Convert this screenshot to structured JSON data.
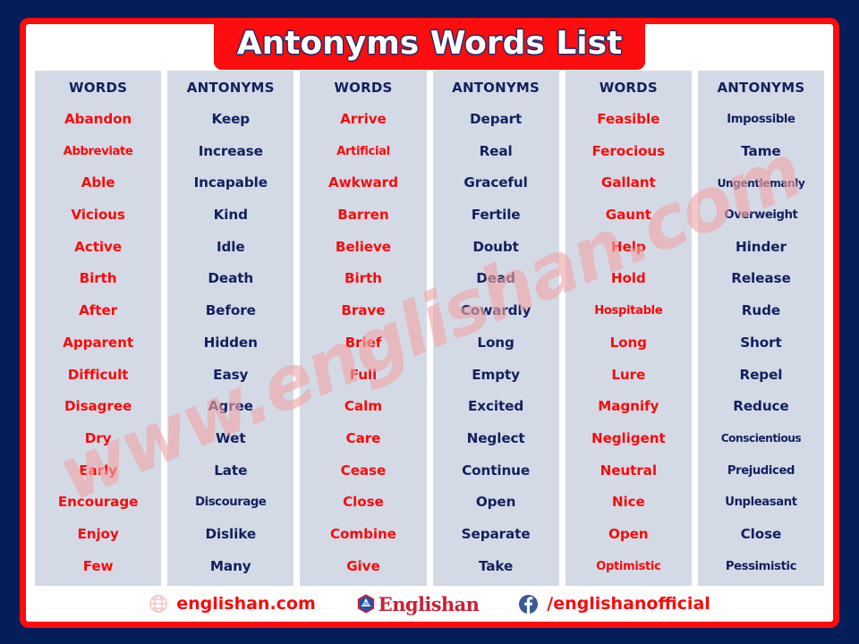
{
  "page": {
    "title": "Antonyms Words List",
    "background_color": "#041e5a",
    "border_color": "#fd0d0d",
    "cell_background": "#d3dae6",
    "word_color": "#fb0a0a",
    "antonym_color": "#13205e"
  },
  "table": {
    "headers": [
      "WORDS",
      "ANTONYMS",
      "WORDS",
      "ANTONYMS",
      "WORDS",
      "ANTONYMS"
    ],
    "columns": [
      {
        "header": "WORDS",
        "kind": "words",
        "cells": [
          "Abandon",
          "Abbreviate",
          "Able",
          "Vicious",
          "Active",
          "Birth",
          "After",
          "Apparent",
          "Difficult",
          "Disagree",
          "Dry",
          "Early",
          "Encourage",
          "Enjoy",
          "Few"
        ]
      },
      {
        "header": "ANTONYMS",
        "kind": "antonyms",
        "cells": [
          "Keep",
          "Increase",
          "Incapable",
          "Kind",
          "Idle",
          "Death",
          "Before",
          "Hidden",
          "Easy",
          "Agree",
          "Wet",
          "Late",
          "Discourage",
          "Dislike",
          "Many"
        ]
      },
      {
        "header": "WORDS",
        "kind": "words",
        "cells": [
          "Arrive",
          "Artificial",
          "Awkward",
          "Barren",
          "Believe",
          "Birth",
          "Brave",
          "Brief",
          "Full",
          "Calm",
          "Care",
          "Cease",
          "Close",
          "Combine",
          "Give"
        ]
      },
      {
        "header": "ANTONYMS",
        "kind": "antonyms",
        "cells": [
          "Depart",
          "Real",
          "Graceful",
          "Fertile",
          "Doubt",
          "Dead",
          "Cowardly",
          "Long",
          "Empty",
          "Excited",
          "Neglect",
          "Continue",
          "Open",
          "Separate",
          "Take"
        ]
      },
      {
        "header": "WORDS",
        "kind": "words",
        "cells": [
          "Feasible",
          "Ferocious",
          "Gallant",
          "Gaunt",
          "Help",
          "Hold",
          "Hospitable",
          "Long",
          "Lure",
          "Magnify",
          "Negligent",
          "Neutral",
          "Nice",
          "Open",
          "Optimistic"
        ]
      },
      {
        "header": "ANTONYMS",
        "kind": "antonyms",
        "cells": [
          "Impossible",
          "Tame",
          "Ungentlemanly",
          "Overweight",
          "Hinder",
          "Release",
          "Rude",
          "Short",
          "Repel",
          "Reduce",
          "Conscientious",
          "Prejudiced",
          "Unpleasant",
          "Close",
          "Pessimistic"
        ]
      }
    ]
  },
  "watermark": {
    "text": "www.englishan.com",
    "color": "#f0a6a6"
  },
  "footer": {
    "website": {
      "icon": "globe-icon",
      "label": "englishan.com"
    },
    "brand": {
      "icon": "englishan-logo-icon",
      "label": "Englishan"
    },
    "facebook": {
      "icon": "facebook-icon",
      "label": "/englishanofficial"
    }
  }
}
